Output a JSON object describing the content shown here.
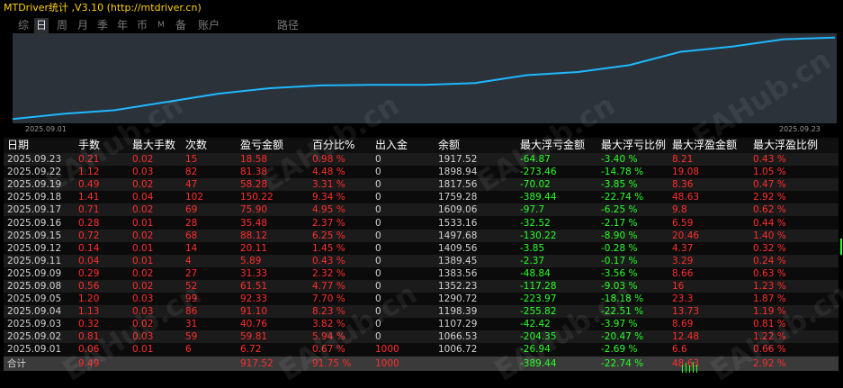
{
  "window": {
    "title": "MTDriver统计 ,V3.10 (http://mtdriver.cn)"
  },
  "tabs": [
    {
      "label": "综",
      "active": false
    },
    {
      "label": "日",
      "active": true
    },
    {
      "label": "周",
      "active": false
    },
    {
      "label": "月",
      "active": false
    },
    {
      "label": "季",
      "active": false
    },
    {
      "label": "年",
      "active": false
    },
    {
      "label": "币",
      "active": false
    },
    {
      "label": "M",
      "active": false
    },
    {
      "label": "备",
      "active": false
    },
    {
      "label": "账户",
      "active": false
    },
    {
      "label": "路径",
      "active": false
    }
  ],
  "chart_data": {
    "type": "line",
    "x_start_label": "2025.09.01",
    "x_end_label": "2025.09.23",
    "x": [
      "2025.09.01",
      "2025.09.02",
      "2025.09.03",
      "2025.09.04",
      "2025.09.05",
      "2025.09.08",
      "2025.09.09",
      "2025.09.10",
      "2025.09.11",
      "2025.09.12",
      "2025.09.15",
      "2025.09.16",
      "2025.09.17",
      "2025.09.18",
      "2025.09.19",
      "2025.09.22",
      "2025.09.23"
    ],
    "series": [
      {
        "values": [
          1006.72,
          1066.53,
          1107.29,
          1198.39,
          1290.72,
          1352.23,
          1383.56,
          1389.45,
          1389.45,
          1409.56,
          1497.68,
          1533.16,
          1609.06,
          1759.28,
          1817.56,
          1898.94,
          1917.52
        ],
        "color": "#1fb8ff"
      }
    ],
    "ylim": [
      1000,
      1925
    ],
    "grid": false
  },
  "table": {
    "headers": [
      "日期",
      "手数",
      "最大手数",
      "次数",
      "盈亏金额",
      "百分比%",
      "出入金",
      "余额",
      "最大浮亏金额",
      "最大浮亏比例",
      "最大浮盈金额",
      "最大浮盈比例"
    ],
    "rows": [
      [
        "2025.09.23",
        "0.21",
        "0.02",
        "15",
        "18.58",
        "0.98 %",
        "0",
        "1917.52",
        "-64.87",
        "-3.40 %",
        "8.21",
        "0.43 %"
      ],
      [
        "2025.09.22",
        "1.12",
        "0.03",
        "82",
        "81.38",
        "4.48 %",
        "0",
        "1898.94",
        "-273.46",
        "-14.78 %",
        "19.08",
        "1.05 %"
      ],
      [
        "2025.09.19",
        "0.49",
        "0.02",
        "47",
        "58.28",
        "3.31 %",
        "0",
        "1817.56",
        "-70.02",
        "-3.85 %",
        "8.36",
        "0.47 %"
      ],
      [
        "2025.09.18",
        "1.41",
        "0.04",
        "102",
        "150.22",
        "9.34 %",
        "0",
        "1759.28",
        "-389.44",
        "-22.74 %",
        "48.63",
        "2.92 %"
      ],
      [
        "2025.09.17",
        "0.71",
        "0.02",
        "69",
        "75.90",
        "4.95 %",
        "0",
        "1609.06",
        "-97.7",
        "-6.25 %",
        "9.8",
        "0.62 %"
      ],
      [
        "2025.09.16",
        "0.28",
        "0.01",
        "28",
        "35.48",
        "2.37 %",
        "0",
        "1533.16",
        "-32.52",
        "-2.17 %",
        "6.59",
        "0.44 %"
      ],
      [
        "2025.09.15",
        "0.72",
        "0.02",
        "68",
        "88.12",
        "6.25 %",
        "0",
        "1497.68",
        "-130.22",
        "-8.90 %",
        "20.46",
        "1.40 %"
      ],
      [
        "2025.09.12",
        "0.14",
        "0.01",
        "14",
        "20.11",
        "1.45 %",
        "0",
        "1409.56",
        "-3.85",
        "-0.28 %",
        "4.37",
        "0.32 %"
      ],
      [
        "2025.09.11",
        "0.04",
        "0.01",
        "4",
        "5.89",
        "0.43 %",
        "0",
        "1389.45",
        "-2.37",
        "-0.17 %",
        "3.29",
        "0.24 %"
      ],
      [
        "2025.09.09",
        "0.29",
        "0.02",
        "27",
        "31.33",
        "2.32 %",
        "0",
        "1383.56",
        "-48.84",
        "-3.56 %",
        "8.66",
        "0.63 %"
      ],
      [
        "2025.09.08",
        "0.56",
        "0.02",
        "52",
        "61.51",
        "4.77 %",
        "0",
        "1352.23",
        "-117.28",
        "-9.03 %",
        "16",
        "1.23 %"
      ],
      [
        "2025.09.05",
        "1.20",
        "0.03",
        "99",
        "92.33",
        "7.70 %",
        "0",
        "1290.72",
        "-223.97",
        "-18.18 %",
        "23.3",
        "1.87 %"
      ],
      [
        "2025.09.04",
        "1.13",
        "0.03",
        "86",
        "91.10",
        "8.23 %",
        "0",
        "1198.39",
        "-255.82",
        "-22.51 %",
        "13.73",
        "1.19 %"
      ],
      [
        "2025.09.03",
        "0.32",
        "0.02",
        "31",
        "40.76",
        "3.82 %",
        "0",
        "1107.29",
        "-42.42",
        "-3.97 %",
        "8.69",
        "0.81 %"
      ],
      [
        "2025.09.02",
        "0.81",
        "0.03",
        "59",
        "59.81",
        "5.94 %",
        "0",
        "1066.53",
        "-204.35",
        "-20.47 %",
        "12.48",
        "1.22 %"
      ],
      [
        "2025.09.01",
        "0.06",
        "0.01",
        "6",
        "6.72",
        "0.67 %",
        "1000",
        "1006.72",
        "-26.94",
        "-2.69 %",
        "6.6",
        "0.66 %"
      ]
    ],
    "footer": [
      "合计",
      "9.49",
      "",
      "",
      "917.52",
      "91.75 %",
      "1000",
      "",
      "-389.44",
      "-22.74 %",
      "48.63",
      "2.92 %"
    ]
  },
  "watermark": "EAHub.cn",
  "colors": {
    "positive": "#ff2d2d",
    "negative": "#26ff26",
    "line": "#1fb8ff",
    "title": "#ffd200"
  }
}
